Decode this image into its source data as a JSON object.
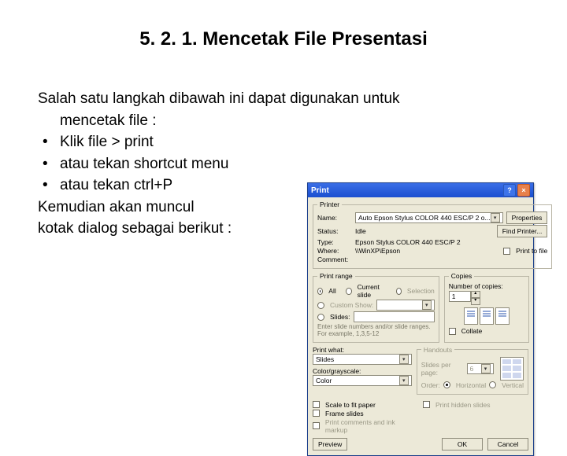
{
  "title": "5. 2. 1. Mencetak File Presentasi",
  "para_lead": "Salah satu langkah dibawah ini dapat digunakan untuk",
  "para_lead2": "mencetak file :",
  "bullets": [
    "Klik file > print",
    "atau tekan shortcut menu",
    "atau tekan ctrl+P"
  ],
  "para_after1": "Kemudian akan muncul",
  "para_after2": "kotak dialog sebagai berikut :",
  "dialog": {
    "title": "Print",
    "printer": {
      "legend": "Printer",
      "name_label": "Name:",
      "name_value": "Auto Epson Stylus COLOR 440 ESC/P 2 o...",
      "status_label": "Status:",
      "status_value": "Idle",
      "type_label": "Type:",
      "type_value": "Epson Stylus COLOR 440 ESC/P 2",
      "where_label": "Where:",
      "where_value": "\\\\WinXP\\Epson",
      "comment_label": "Comment:",
      "properties_btn": "Properties",
      "find_printer_btn": "Find Printer...",
      "print_to_file": "Print to file"
    },
    "range": {
      "legend": "Print range",
      "all": "All",
      "current": "Current slide",
      "selection": "Selection",
      "custom": "Custom Show:",
      "slides_label": "Slides:",
      "note": "Enter slide numbers and/or slide ranges. For example, 1,3,5-12"
    },
    "copies": {
      "legend": "Copies",
      "number_label": "Number of copies:",
      "value": "1",
      "collate": "Collate"
    },
    "printwhat": {
      "label": "Print what:",
      "value": "Slides",
      "color_label": "Color/grayscale:",
      "color_value": "Color"
    },
    "handouts": {
      "legend": "Handouts",
      "slides_per_page": "Slides per page:",
      "spp_value": "6",
      "order_label": "Order:",
      "horiz": "Horizontal",
      "vert": "Vertical"
    },
    "options": {
      "scale": "Scale to fit paper",
      "frame": "Frame slides",
      "comments": "Print comments and ink markup",
      "hidden": "Print hidden slides"
    },
    "footer": {
      "preview": "Preview",
      "ok": "OK",
      "cancel": "Cancel"
    }
  }
}
